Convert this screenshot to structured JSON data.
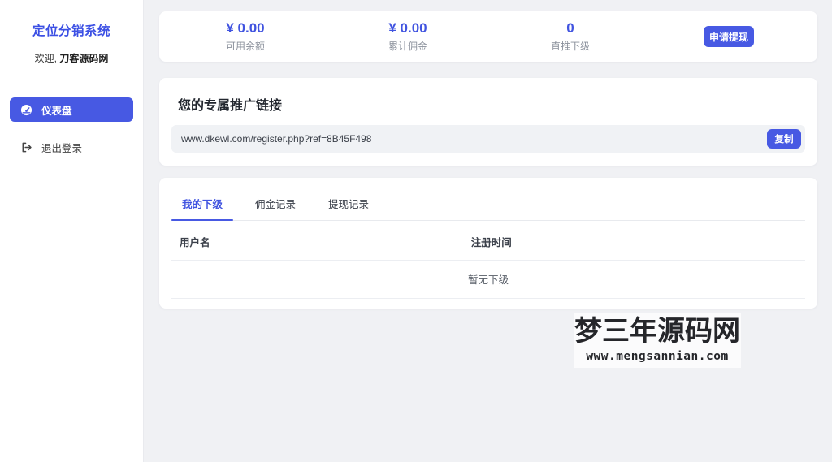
{
  "app": {
    "title": "定位分销系统",
    "welcome_prefix": "欢迎,",
    "username": "刀客源码网"
  },
  "sidebar": {
    "items": [
      {
        "label": "仪表盘",
        "icon": "dashboard-icon",
        "active": true
      },
      {
        "label": "退出登录",
        "icon": "logout-icon",
        "active": false
      }
    ]
  },
  "stats": {
    "items": [
      {
        "value": "¥ 0.00",
        "label": "可用余额"
      },
      {
        "value": "¥ 0.00",
        "label": "累计佣金"
      },
      {
        "value": "0",
        "label": "直推下级"
      }
    ],
    "withdraw_button": "申请提现"
  },
  "promo": {
    "title": "您的专属推广链接",
    "link": "www.dkewl.com/register.php?ref=8B45F498",
    "copy_button": "复制"
  },
  "tabs": [
    {
      "label": "我的下级",
      "active": true
    },
    {
      "label": "佣金记录",
      "active": false
    },
    {
      "label": "提现记录",
      "active": false
    }
  ],
  "table": {
    "headers": [
      "用户名",
      "注册时间"
    ],
    "empty_text": "暂无下级"
  },
  "watermark": {
    "line1": "梦三年源码网",
    "line2": "www.mengsannian.com"
  },
  "colors": {
    "accent": "#4759e3",
    "accent_text": "#4154e0",
    "page_background": "#f0f1f4",
    "card_background": "#ffffff",
    "muted_text": "#8a909b"
  }
}
